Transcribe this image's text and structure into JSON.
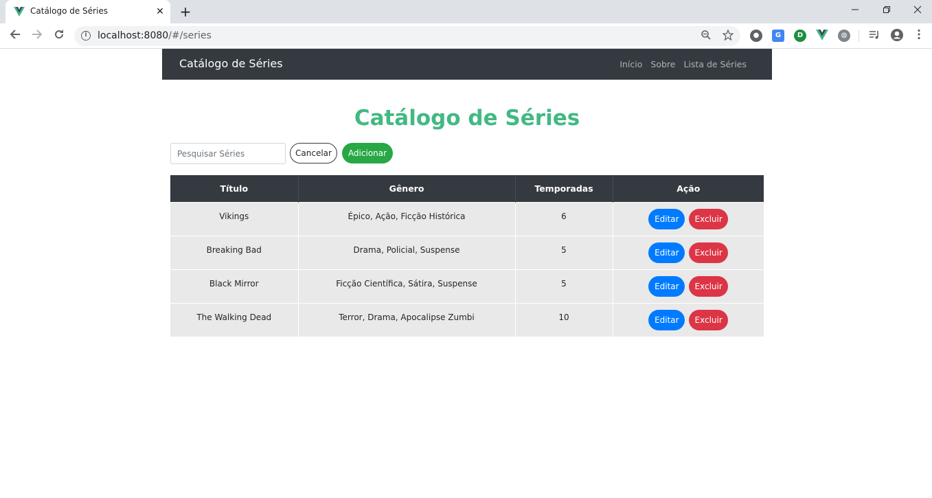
{
  "browser": {
    "tab_title": "Catálogo de Séries",
    "url_host": "localhost:8080",
    "url_path": "/#/series",
    "controls": {
      "new_tab": "+",
      "close": "✕",
      "minimize": "—",
      "restore": "❐",
      "window_close": "✕"
    },
    "icons": [
      "back-icon",
      "forward-icon",
      "reload-icon",
      "info-icon",
      "zoom-icon",
      "star-icon",
      "extension-icons",
      "media-icon",
      "profile-icon",
      "menu-icon"
    ]
  },
  "navbar": {
    "brand": "Catálogo de Séries",
    "links": [
      "Início",
      "Sobre",
      "Lista de Séries"
    ]
  },
  "main": {
    "title": "Catálogo de Séries",
    "search_placeholder": "Pesquisar Séries",
    "cancel_label": "Cancelar",
    "add_label": "Adicionar"
  },
  "table": {
    "headers": [
      "Título",
      "Gênero",
      "Temporadas",
      "Ação"
    ],
    "rows": [
      {
        "titulo": "Vikings",
        "genero": "Épico, Ação, Ficção Histórica",
        "temporadas": "6"
      },
      {
        "titulo": "Breaking Bad",
        "genero": "Drama, Policial, Suspense",
        "temporadas": "5"
      },
      {
        "titulo": "Black Mirror",
        "genero": "Ficção Científica, Sátira, Suspense",
        "temporadas": "5"
      },
      {
        "titulo": "The Walking Dead",
        "genero": "Terror, Drama, Apocalipse Zumbi",
        "temporadas": "10"
      }
    ],
    "edit_label": "Editar",
    "delete_label": "Excluir"
  },
  "colors": {
    "accent": "#42b983",
    "navbar": "#343a40",
    "add": "#28a745",
    "edit": "#007bff",
    "delete": "#dc3545"
  }
}
